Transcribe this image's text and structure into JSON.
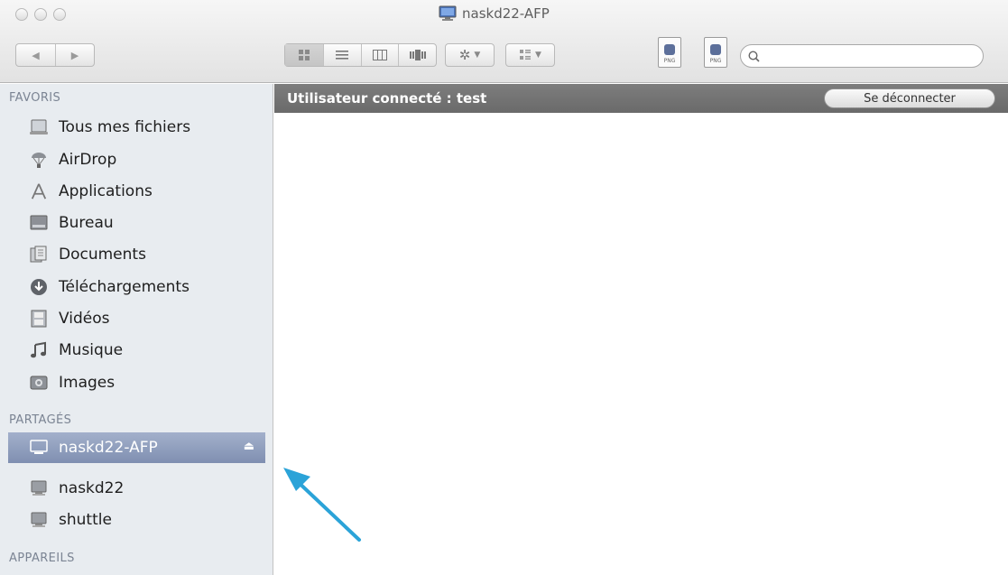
{
  "window": {
    "title": "naskd22-AFP"
  },
  "toolbar": {
    "search_placeholder": "",
    "icons": {
      "back": "chevron-left-icon",
      "forward": "chevron-right-icon",
      "icon_view": "grid-icon",
      "list_view": "list-icon",
      "column_view": "columns-icon",
      "coverflow_view": "coverflow-icon",
      "action": "gear-icon",
      "arrange": "arrange-icon",
      "search": "search-icon"
    },
    "png_file_label": "PNG"
  },
  "sidebar": {
    "favorites_header": "FAVORIS",
    "favorites": [
      {
        "label": "Tous mes fichiers",
        "icon": "all-files-icon"
      },
      {
        "label": "AirDrop",
        "icon": "airdrop-icon"
      },
      {
        "label": "Applications",
        "icon": "applications-icon"
      },
      {
        "label": "Bureau",
        "icon": "desktop-icon"
      },
      {
        "label": "Documents",
        "icon": "documents-icon"
      },
      {
        "label": "Téléchargements",
        "icon": "downloads-icon"
      },
      {
        "label": "Vidéos",
        "icon": "movies-icon"
      },
      {
        "label": "Musique",
        "icon": "music-icon"
      },
      {
        "label": "Images",
        "icon": "pictures-icon"
      }
    ],
    "shared_header": "PARTAGÉS",
    "shared": [
      {
        "label": "naskd22-AFP",
        "icon": "network-display-icon",
        "selected": true
      },
      {
        "label": "naskd22",
        "icon": "server-icon"
      },
      {
        "label": "shuttle",
        "icon": "server-icon"
      }
    ],
    "devices_header": "APPAREILS"
  },
  "main": {
    "connected_user": "Utilisateur connecté : test",
    "disconnect_label": "Se déconnecter"
  },
  "colors": {
    "selection": "#8e9dbd",
    "banner": "#737373",
    "sidebar_bg": "#e8ecf0",
    "annotation_arrow": "#2ba3d8"
  }
}
